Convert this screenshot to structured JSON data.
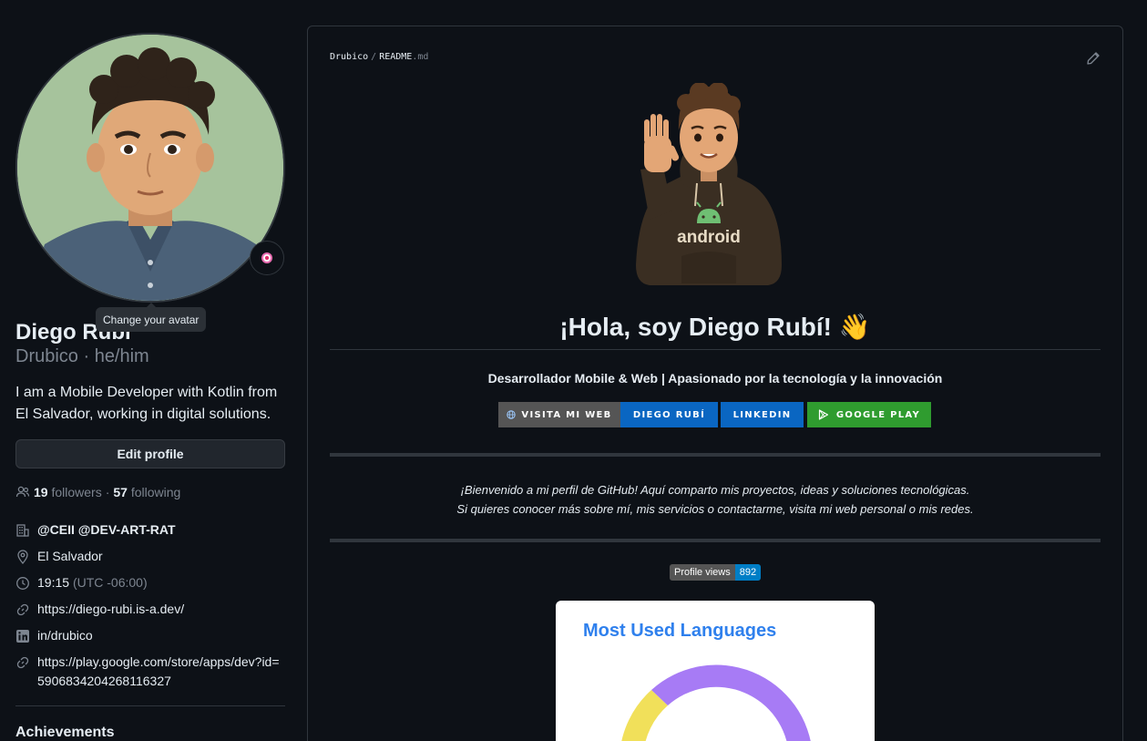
{
  "profile": {
    "name": "Diego Rubí",
    "login_pronouns": "Drubico · he/him",
    "bio": "I am a Mobile Developer with Kotlin from El Salvador, working in digital solutions.",
    "edit_label": "Edit profile",
    "tooltip": "Change your avatar",
    "followers_count": "19",
    "followers_label": "followers",
    "dot": "·",
    "following_count": "57",
    "following_label": "following",
    "org": "@CEII @DEV-ART-RAT",
    "location": "El Salvador",
    "time": "19:15",
    "timezone": "(UTC -06:00)",
    "website": "https://diego-rubi.is-a.dev/",
    "linkedin": "in/drubico",
    "play_link": "https://play.google.com/store/apps/dev?id=5906834204268116327",
    "achievements": "Achievements"
  },
  "readme": {
    "breadcrumb_repo": "Drubico",
    "breadcrumb_sep": "/",
    "breadcrumb_file": "README",
    "breadcrumb_ext": ".md",
    "hoodie_text": "android",
    "heading": "¡Hola, soy Diego Rubí! 👋",
    "tagline": "Desarrollador Mobile & Web | Apasionado por la tecnología y la innovación",
    "badges": {
      "web": "Visita mi web",
      "name": "Diego Rubí",
      "linkedin": "LinkedIn",
      "play": "Google Play"
    },
    "welcome_line1": "¡Bienvenido a mi perfil de GitHub! Aquí comparto mis proyectos, ideas y soluciones tecnológicas.",
    "welcome_line2": "Si quieres conocer más sobre mí, mis servicios o contactarme, visita mi web personal o mis redes.",
    "profile_views_label": "Profile views",
    "profile_views_count": "892",
    "langs_title": "Most Used Languages"
  },
  "colors": {
    "background": "#0d1117",
    "accent_linkedin": "#0a66c2",
    "accent_play": "#2f9c2f",
    "donut_purple": "#a77bf5",
    "donut_yellow": "#f1e05a"
  }
}
